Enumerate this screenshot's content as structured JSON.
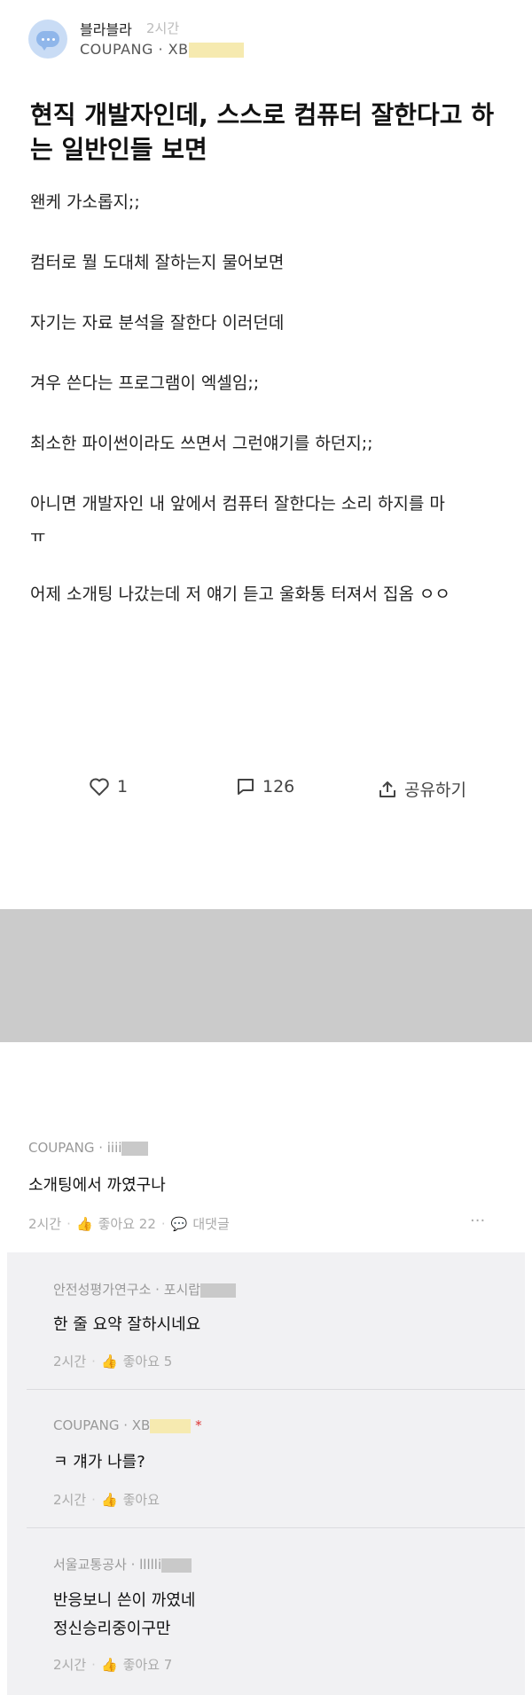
{
  "post": {
    "author": "블라블라",
    "time": "2시간",
    "company": "COUPANG · XB",
    "title": "현직 개발자인데, 스스로 컴퓨터 잘한다고 하는 일반인들 보면",
    "lines": [
      "왠케 가소롭지;;",
      "컴터로 뭘 도대체 잘하는지 물어보면",
      "자기는 자료 분석을 잘한다 이러던데",
      "겨우 쓴다는 프로그램이 엑셀임;;",
      "최소한 파이썬이라도 쓰면서 그런얘기를 하던지;;",
      "아니면 개발자인 내 앞에서 컴퓨터 잘한다는 소리 하지를 마",
      "ㅠ",
      "어제 소개팅 나갔는데 저 얘기 듣고 울화통 터져서 집옴 ㅇㅇ"
    ],
    "likes": "1",
    "comments": "126",
    "share": "공유하기"
  },
  "comment": {
    "meta": "COUPANG · iiii",
    "text": "소개팅에서 까였구나",
    "time": "2시간",
    "likes": "좋아요 22",
    "reply": "대댓글",
    "more": "···"
  },
  "replies": [
    {
      "meta": "안전성평가연구소 · 포시랍",
      "text": "한 줄 요약 잘하시네요",
      "time": "2시간",
      "likes": "좋아요 5"
    },
    {
      "meta": "COUPANG · XB",
      "badge": "*",
      "text": "ㅋ 걔가 나를?",
      "time": "2시간",
      "likes": "좋아요"
    },
    {
      "meta": "서울교통공사 · llllli",
      "text": "반응보니 쓴이 까였네",
      "text2": "정신승리중이구만",
      "time": "2시간",
      "likes": "좋아요 7"
    }
  ],
  "colors": {
    "mask": "#f6eab0",
    "gray": "#cbcbcb",
    "reply_bg": "#f1f1f3"
  }
}
